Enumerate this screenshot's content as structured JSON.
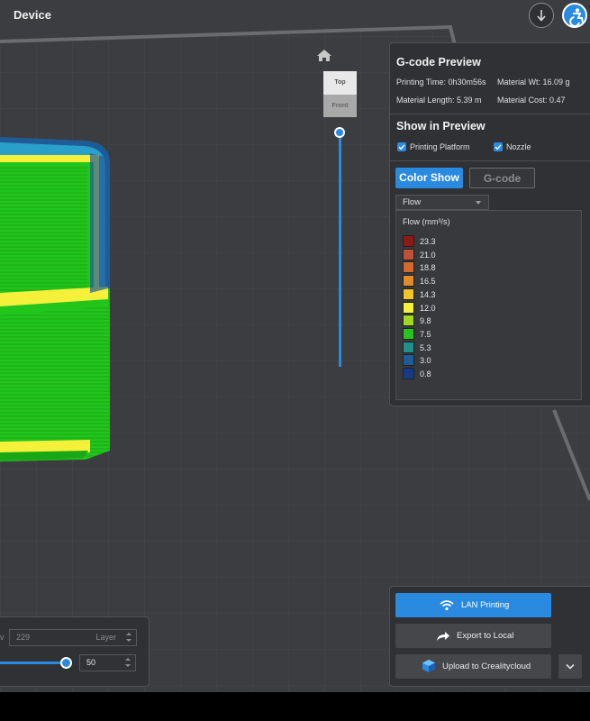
{
  "app": {
    "title": "Device"
  },
  "view": {
    "cube_top_label": "Top",
    "cube_front_label": "Front"
  },
  "gcode_preview": {
    "header": "G-code Preview",
    "printing_time": "Printing Time: 0h30m56s",
    "material_weight": "Material Wt: 16.09 g",
    "material_length": "Material Length: 5.39 m",
    "material_cost": "Material Cost: 0.47"
  },
  "show_in_preview": {
    "header": "Show in Preview",
    "options": [
      {
        "label": "Printing Platform",
        "checked": true
      },
      {
        "label": "Nozzle",
        "checked": true
      }
    ]
  },
  "tabs": {
    "color_show": "Color Show",
    "gcode": "G-code",
    "active": "Color Show"
  },
  "color_mode": {
    "selected": "Flow"
  },
  "legend": {
    "title": "Flow (mm³/s)",
    "items": [
      {
        "value": "23.3",
        "color": "#8b1a12"
      },
      {
        "value": "21.0",
        "color": "#c0503a"
      },
      {
        "value": "18.8",
        "color": "#d2692e"
      },
      {
        "value": "16.5",
        "color": "#e38a2b"
      },
      {
        "value": "14.3",
        "color": "#f2c426"
      },
      {
        "value": "12.0",
        "color": "#f5f03a"
      },
      {
        "value": "9.8",
        "color": "#9fd81f"
      },
      {
        "value": "7.5",
        "color": "#27c41d"
      },
      {
        "value": "5.3",
        "color": "#20908d"
      },
      {
        "value": "3.0",
        "color": "#1f5b97"
      },
      {
        "value": "0.8",
        "color": "#163a86"
      }
    ]
  },
  "actions": {
    "lan_printing": "LAN Printing",
    "export_local": "Export to Local",
    "upload_cloud": "Upload to Crealitycloud"
  },
  "layer_control": {
    "max_layer": "229",
    "layer_unit": "Layer",
    "current_layer": "50",
    "partial_label": "v",
    "slider_fraction": 0.218
  },
  "colors": {
    "accent": "#2a8ae0",
    "panel": "#2f3134",
    "background": "#3b3d40"
  }
}
